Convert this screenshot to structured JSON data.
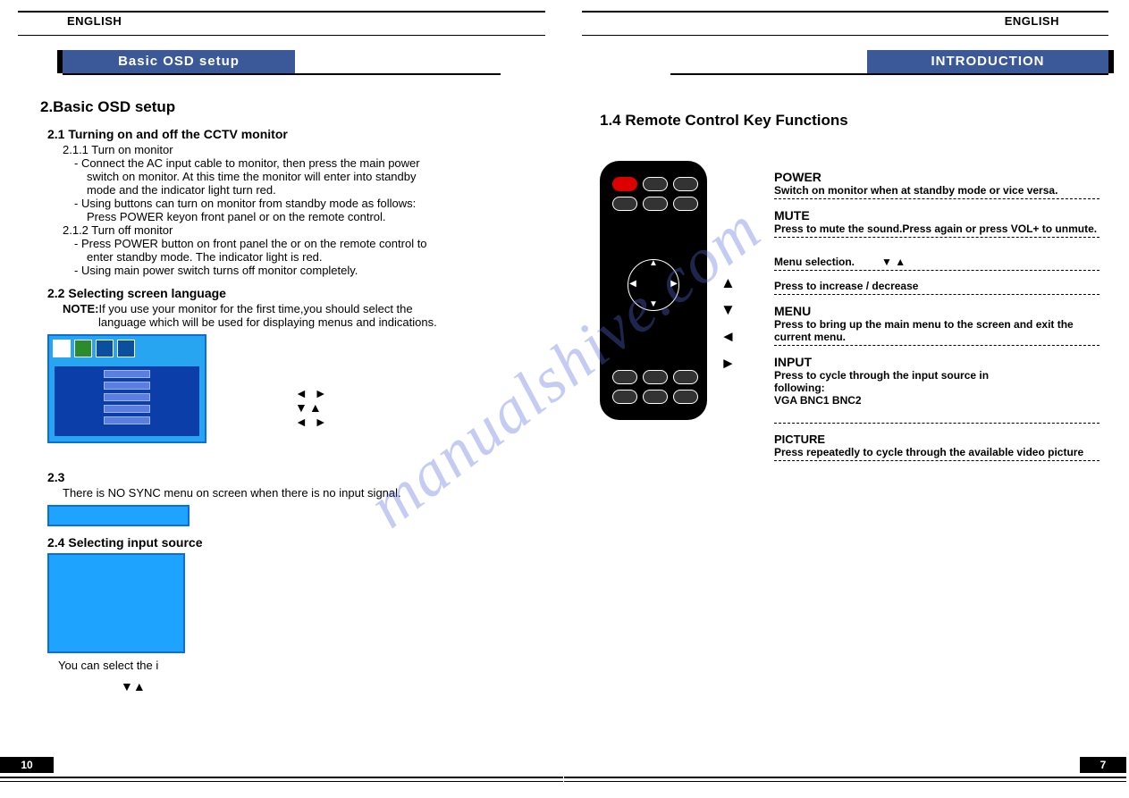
{
  "watermark": "manualshive.com",
  "left_page": {
    "language": "ENGLISH",
    "tab": "Basic OSD setup",
    "h2": "2.Basic OSD setup",
    "s21_title": "2.1 Turning on and off the CCTV monitor",
    "s211": "2.1.1  Turn on monitor",
    "s211_a1": "- Connect the AC input cable to monitor, then press the main power",
    "s211_a2": "switch on monitor. At this time the monitor will enter into standby",
    "s211_a3": "mode and the indicator light turn red.",
    "s211_b1": "- Using buttons can turn on monitor from standby mode as follows:",
    "s211_b2": "Press POWER keyon front panel or on the remote control.",
    "s212": "2.1.2  Turn off monitor",
    "s212_a1": "- Press POWER button on front panel the or on the remote control to",
    "s212_a2": "enter standby mode. The indicator light is red.",
    "s212_b": "- Using main power switch turns off monitor completely.",
    "s22_title": "2.2 Selecting screen language",
    "s22_note_label": "NOTE:",
    "s22_note1": "If you use your monitor for the first time,you should select the",
    "s22_note2": "language which will be used for displaying menus and indications.",
    "arrows_cluster_1": "◄ ►",
    "arrows_cluster_2": "▼▲",
    "arrows_cluster_3": "◄ ►",
    "s23": "2.3",
    "s23_body": "There is NO SYNC menu on screen when there is no input signal.",
    "s24_title": "2.4 Selecting input source",
    "s24_tail": "You can select the i",
    "s24_arrows": "▼▲",
    "page_num": "10"
  },
  "right_page": {
    "language": "ENGLISH",
    "tab": "INTRODUCTION",
    "h2": "1.4 Remote Control Key Functions",
    "arrow_up": "▲",
    "arrow_down": "▼",
    "arrow_left": "◄",
    "arrow_right": "►",
    "power_t": "POWER",
    "power_d": "Switch on monitor when at standby mode or vice versa.",
    "mute_t": "MUTE",
    "mute_d": "Press to mute the sound.Press again or press VOL+   to unmute.",
    "menusel_d": "Menu selection.",
    "menusel_arr": "▼ ▲",
    "incdec_d": "Press to increase / decrease",
    "menu_t": "MENU",
    "menu_d": "Press to bring up the main menu to the screen and exit the current menu.",
    "input_t": "INPUT",
    "input_d1": "Press to cycle through the input source in",
    "input_d2": " following:",
    "input_d3": "VGA      BNC1      BNC2",
    "picture_t": "PICTURE",
    "picture_d": "Press repeatedly to cycle through the available video picture",
    "page_num": "7"
  }
}
